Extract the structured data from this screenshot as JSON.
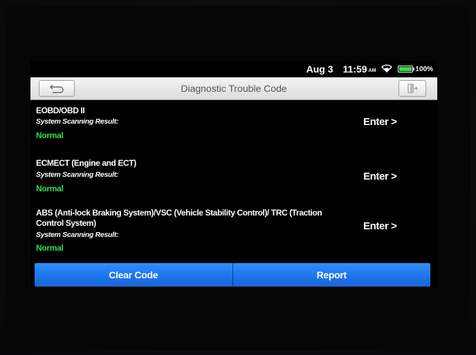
{
  "status_bar": {
    "date": "Aug 3",
    "time": "11:59",
    "ampm": "AM",
    "battery_level": 1.0,
    "battery_percent": "100%",
    "battery_color": "#2ee53a"
  },
  "header": {
    "title": "Diagnostic Trouble Code"
  },
  "systems": [
    {
      "name": "EOBD/OBD II",
      "scan_label": "System Scanning Result:",
      "status": "Normal",
      "enter_label": "Enter >"
    },
    {
      "name": "ECMECT (Engine and ECT)",
      "scan_label": "System Scanning Result:",
      "status": "Normal",
      "enter_label": "Enter >"
    },
    {
      "name": "ABS (Anti-lock Braking System)/VSC (Vehicle Stability Control)/ TRC (Traction Control System)",
      "scan_label": "System Scanning Result:",
      "status": "Normal",
      "enter_label": "Enter >"
    }
  ],
  "actions": {
    "clear_code_label": "Clear Code",
    "report_label": "Report"
  },
  "colors": {
    "accent_blue": "#1e73ea",
    "status_green": "#36d94b"
  }
}
